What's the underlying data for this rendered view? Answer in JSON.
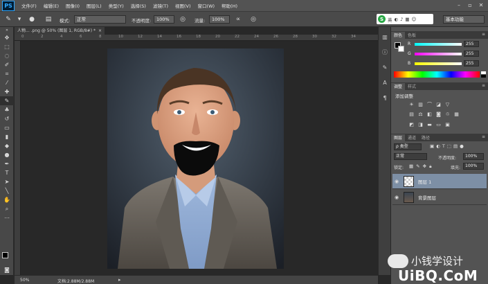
{
  "app": {
    "logo": "PS",
    "menu": [
      "文件(F)",
      "编辑(E)",
      "图像(I)",
      "图层(L)",
      "类型(Y)",
      "选择(S)",
      "滤镜(T)",
      "视图(V)",
      "窗口(W)",
      "帮助(H)"
    ]
  },
  "options": {
    "mode_label": "模式:",
    "mode_value": "正常",
    "opacity_label": "不透明度:",
    "opacity_value": "100%",
    "flow_label": "流量:",
    "flow_value": "100%",
    "workspace": "基本功能"
  },
  "ime": {
    "label": "英"
  },
  "document": {
    "tab_title": "人物... .png @ 50% (图层 1, RGB/8#) *",
    "ruler_numbers": [
      "0",
      "2",
      "4",
      "6",
      "8",
      "10",
      "12",
      "14",
      "16",
      "18",
      "20",
      "22",
      "24",
      "26",
      "28",
      "30",
      "32",
      "34"
    ]
  },
  "status": {
    "zoom": "50%",
    "doc_size": "文档:2.88M/2.88M"
  },
  "color_panel": {
    "tabs": [
      "颜色",
      "色板"
    ],
    "sliders": [
      {
        "letter": "R",
        "value": "255"
      },
      {
        "letter": "G",
        "value": "255"
      },
      {
        "letter": "B",
        "value": "255"
      }
    ]
  },
  "adjust_panel": {
    "tabs": [
      "调整",
      "样式"
    ],
    "heading": "添加调整"
  },
  "layers_panel": {
    "tabs": [
      "图层",
      "通道",
      "路径"
    ],
    "filter_value": "ρ 类型",
    "blend_value": "正常",
    "opacity_label": "不透明度:",
    "opacity_value": "100%",
    "lock_label": "锁定:",
    "fill_label": "填充:",
    "fill_value": "100%",
    "layers": [
      {
        "name": "图层 1",
        "selected": true
      },
      {
        "name": "背景图层",
        "selected": false
      }
    ]
  },
  "watermarks": {
    "wechat_text": "小钱学设计",
    "site": "UiBQ.CoM"
  },
  "colors": {
    "accent": "#31a8ff",
    "selected_layer": "#7d8fa5"
  }
}
